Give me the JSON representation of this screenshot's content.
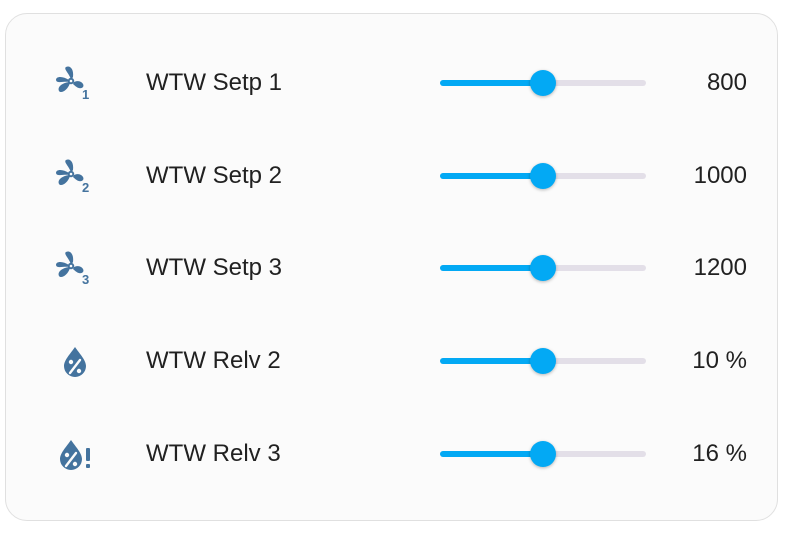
{
  "colors": {
    "icon": "#44739e",
    "slider_active": "#03a9f4",
    "slider_track": "#e3dfe8",
    "text": "#212121"
  },
  "entities": [
    {
      "icon": "fan-speed-1-icon",
      "icon_digit": "1",
      "name": "WTW Setp 1",
      "value": "800",
      "slider_fraction": 0.5
    },
    {
      "icon": "fan-speed-2-icon",
      "icon_digit": "2",
      "name": "WTW Setp 2",
      "value": "1000",
      "slider_fraction": 0.5
    },
    {
      "icon": "fan-speed-3-icon",
      "icon_digit": "3",
      "name": "WTW Setp 3",
      "value": "1200",
      "slider_fraction": 0.5
    },
    {
      "icon": "water-percent-icon",
      "name": "WTW Relv 2",
      "value": "10 %",
      "slider_fraction": 0.5
    },
    {
      "icon": "water-percent-alert-icon",
      "name": "WTW Relv 3",
      "value": "16 %",
      "slider_fraction": 0.5
    }
  ]
}
